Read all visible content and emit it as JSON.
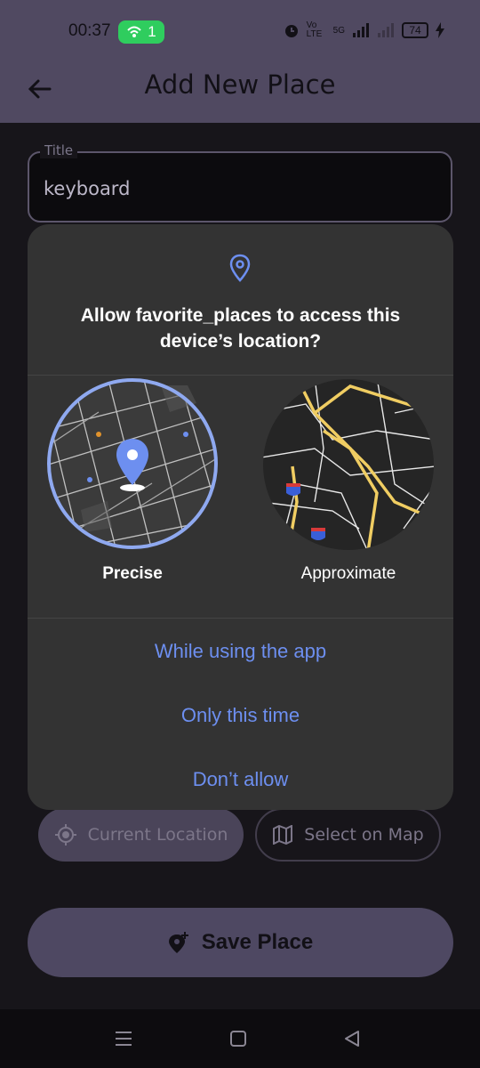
{
  "status_bar": {
    "time": "00:37",
    "hotspot_count": "1",
    "network_label": "Vo LTE",
    "signal_label": "5G",
    "battery": "74"
  },
  "app_bar": {
    "title": "Add New Place"
  },
  "form": {
    "title_label": "Title",
    "title_value": "keyboard",
    "current_location_label": "Current Location",
    "select_on_map_label": "Select on Map",
    "save_label": "Save Place"
  },
  "permission_dialog": {
    "title": "Allow favorite_places to access this device’s location?",
    "precise_label": "Precise",
    "approximate_label": "Approximate",
    "actions": [
      "While using the app",
      "Only this time",
      "Don’t allow"
    ],
    "selected_option": "Precise"
  },
  "colors": {
    "app_bar": "#504961",
    "dialog": "#333333",
    "accent": "#6d8ff0",
    "precise_ring": "#8fa9f0"
  },
  "icons": [
    "hotspot-icon",
    "alarm-icon",
    "charging-icon",
    "back-arrow-icon",
    "location-pin-icon",
    "crosshair-icon",
    "map-icon",
    "add-location-icon",
    "menu-nav-icon",
    "home-nav-icon",
    "back-nav-icon"
  ]
}
